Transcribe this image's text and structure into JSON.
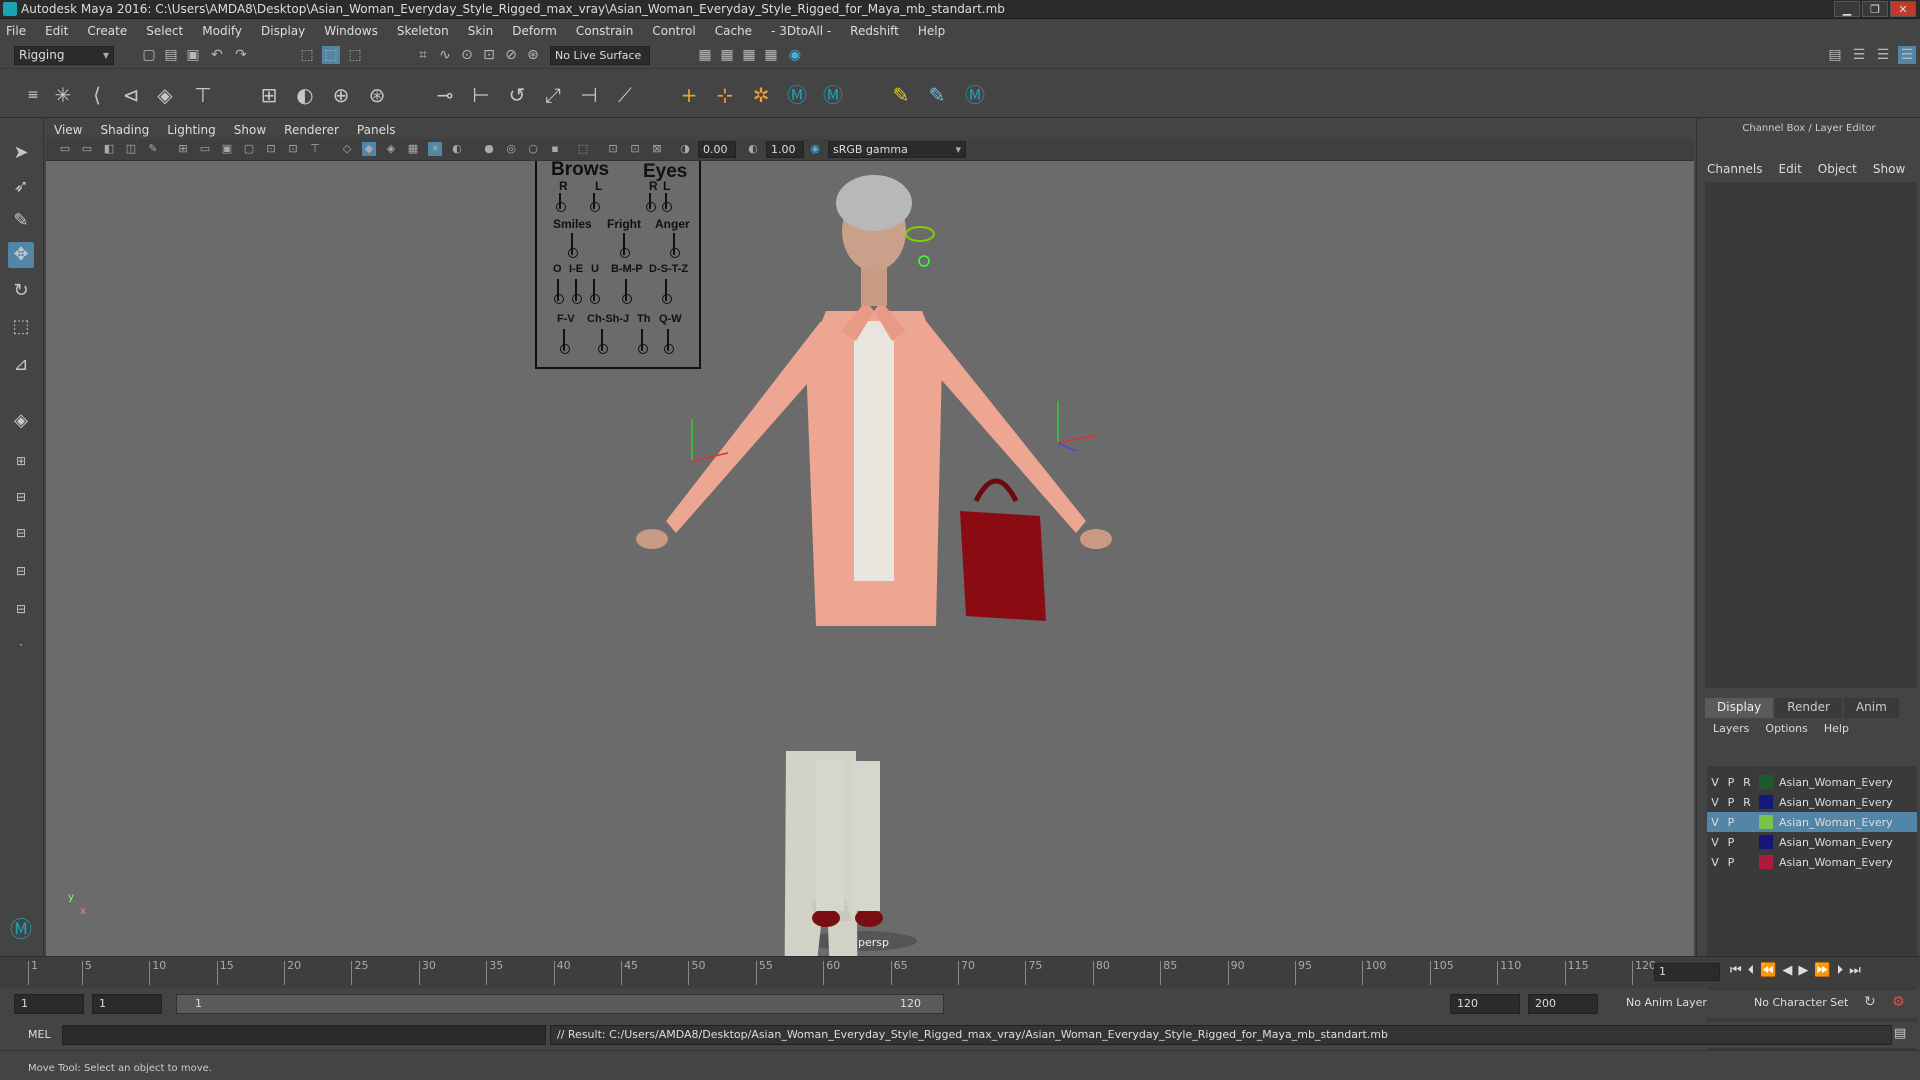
{
  "window": {
    "title": "Autodesk Maya 2016: C:\\Users\\AMDA8\\Desktop\\Asian_Woman_Everyday_Style_Rigged_max_vray\\Asian_Woman_Everyday_Style_Rigged_for_Maya_mb_standart.mb",
    "min": "▁",
    "max": "❐",
    "close": "✕"
  },
  "menubar": [
    "File",
    "Edit",
    "Create",
    "Select",
    "Modify",
    "Display",
    "Windows",
    "Skeleton",
    "Skin",
    "Deform",
    "Constrain",
    "Control",
    "Cache",
    "- 3DtoAll -",
    "Redshift",
    "Help"
  ],
  "shelf": {
    "mode": "Rigging",
    "live_surface": "No Live Surface"
  },
  "viewport": {
    "menu": [
      "View",
      "Shading",
      "Lighting",
      "Show",
      "Renderer",
      "Panels"
    ],
    "exposure": "0.00",
    "gamma_value": "1.00",
    "colorspace": "sRGB gamma",
    "camera_label": "persp",
    "axis_y": "y",
    "axis_x": "x"
  },
  "face_controls": {
    "brows": "Brows",
    "eyes": "Eyes",
    "r1": "R",
    "l1": "L",
    "r2": "R",
    "l2": "L",
    "smiles": "Smiles",
    "fright": "Fright",
    "anger": "Anger",
    "o": "O",
    "ie": "I-E",
    "u": "U",
    "bmp": "B-M-P",
    "dstz": "D-S-T-Z",
    "fv": "F-V",
    "chshj": "Ch-Sh-J",
    "th": "Th",
    "qw": "Q-W"
  },
  "channel_box": {
    "title": "Channel Box / Layer Editor",
    "tabs": [
      "Channels",
      "Edit",
      "Object",
      "Show"
    ]
  },
  "layer_editor": {
    "tabs": [
      "Display",
      "Render",
      "Anim"
    ],
    "menu": [
      "Layers",
      "Options",
      "Help"
    ],
    "layers": [
      {
        "v": "V",
        "p": "P",
        "r": "R",
        "name": "Asian_Woman_Everyday_Style_Rigged",
        "color": "#1f5a2e"
      },
      {
        "v": "V",
        "p": "P",
        "r": "R",
        "name": "Asian_Woman_Everyday_Style_Controllers",
        "color": "#141a7a"
      },
      {
        "v": "V",
        "p": "P",
        "r": "",
        "name": "Asian_Woman_Everyday_Style_Bones",
        "color": "#7bc24a"
      },
      {
        "v": "V",
        "p": "P",
        "r": "",
        "name": "Asian_Woman_Everyday_Style_Helpers",
        "color": "#15157a"
      },
      {
        "v": "V",
        "p": "P",
        "r": "",
        "name": "Asian_Woman_Everyday_Style_Geometry",
        "color": "#b01a3a"
      }
    ]
  },
  "timeline": {
    "ticks": [
      "1",
      "5",
      "10",
      "15",
      "20",
      "25",
      "30",
      "35",
      "40",
      "45",
      "50",
      "55",
      "60",
      "65",
      "70",
      "75",
      "80",
      "85",
      "90",
      "95",
      "100",
      "105",
      "110",
      "115",
      "120"
    ],
    "current_frame": "1"
  },
  "range": {
    "start": "1",
    "playback_start": "1",
    "slider_start": "1",
    "slider_end": "120",
    "playback_end": "120",
    "end": "200",
    "anim_layer": "No Anim Layer",
    "char_set": "No Character Set"
  },
  "command": {
    "lang": "MEL",
    "result": "// Result: C:/Users/AMDA8/Desktop/Asian_Woman_Everyday_Style_Rigged_max_vray/Asian_Woman_Everyday_Style_Rigged_for_Maya_mb_standart.mb"
  },
  "help_line": "Move Tool: Select an object to move."
}
